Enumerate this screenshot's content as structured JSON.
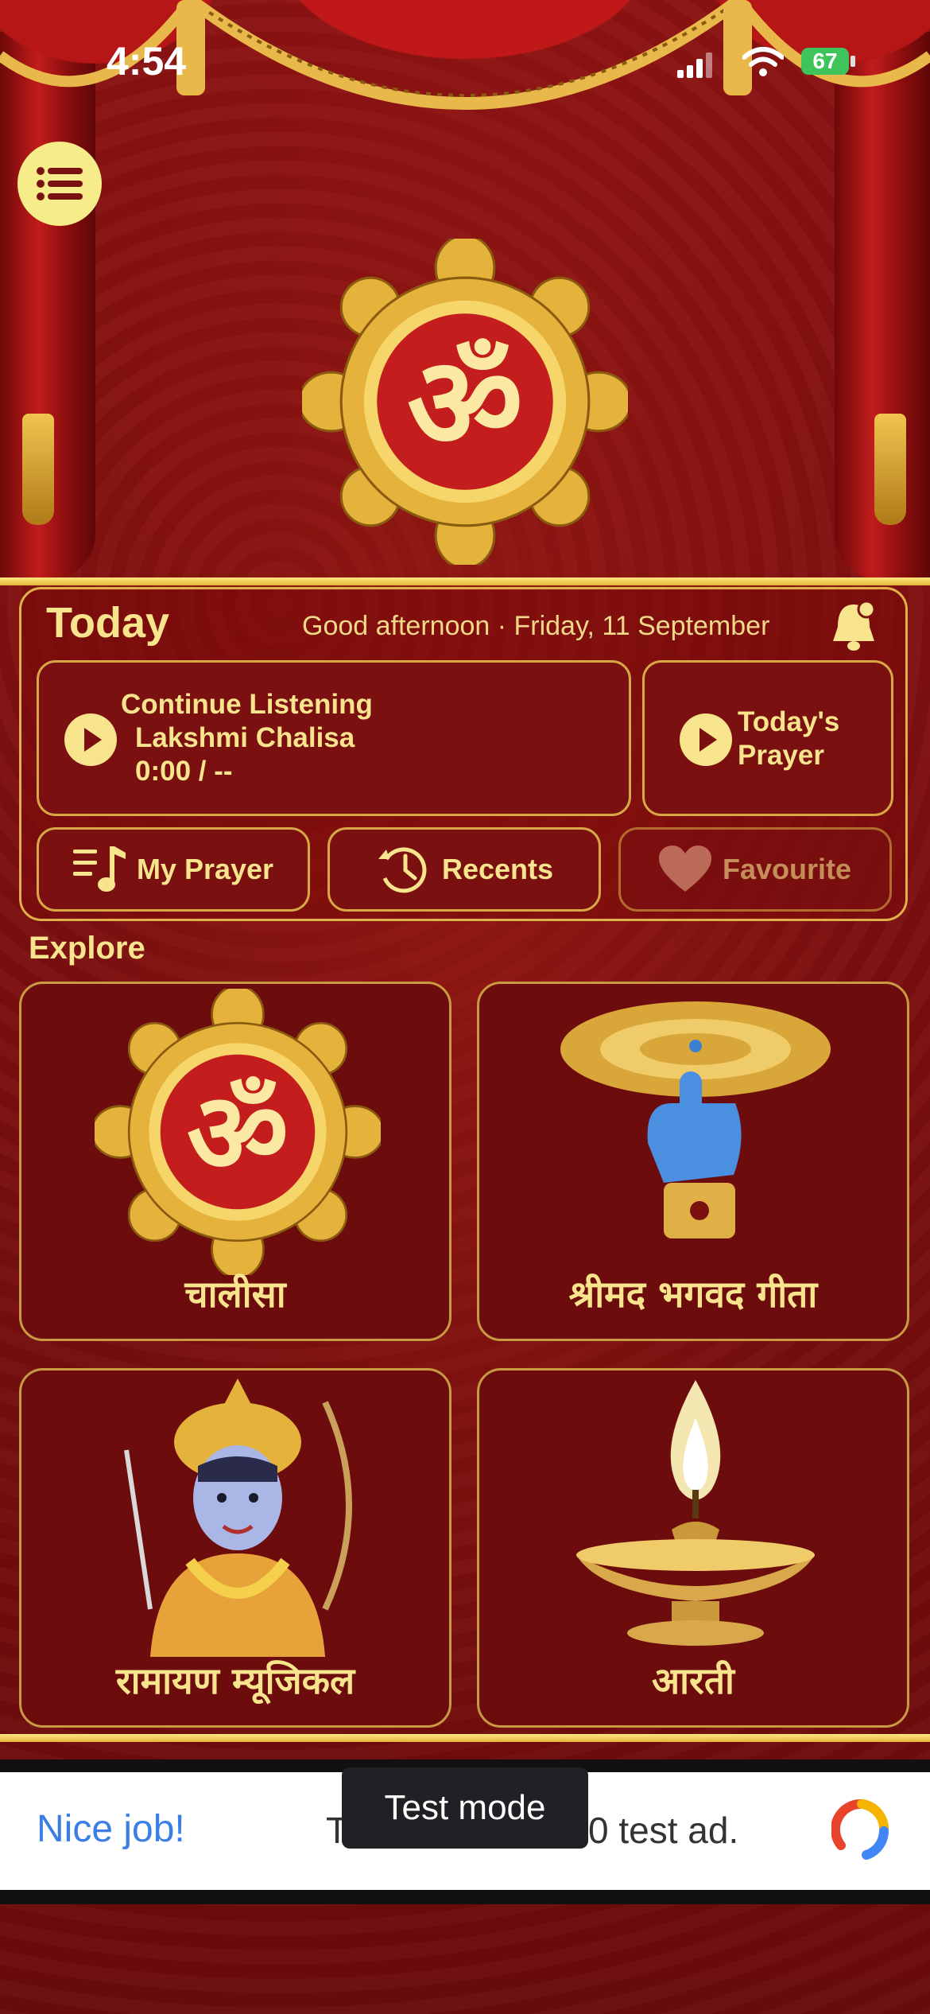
{
  "status_bar": {
    "time": "4:54",
    "battery": "67"
  },
  "today": {
    "title": "Today",
    "greeting": "Good afternoon · Friday, 11 September"
  },
  "continue_listening": {
    "label": "Continue Listening",
    "track": "Lakshmi Chalisa",
    "progress": "0:00 / --"
  },
  "todays_prayer": {
    "line1": "Today's",
    "line2": "Prayer"
  },
  "quick_actions": [
    {
      "label": "My Prayer",
      "icon": "playlist-music-icon"
    },
    {
      "label": "Recents",
      "icon": "history-icon"
    },
    {
      "label": "Favourite",
      "icon": "heart-icon"
    }
  ],
  "explore": {
    "title": "Explore",
    "tiles": [
      {
        "label": "चालीसा",
        "icon": "om-icon"
      },
      {
        "label": "श्रीमद भगवद गीता",
        "icon": "sudarshan-chakra-icon"
      },
      {
        "label": "रामायण म्यूजिकल",
        "icon": "lord-rama-icon"
      },
      {
        "label": "आरती",
        "icon": "diya-lamp-icon"
      }
    ]
  },
  "ad": {
    "left": "Nice job!",
    "middle_left": "T",
    "middle_right": "0 test ad.",
    "toast": "Test mode"
  },
  "colors": {
    "gold": "#f7e48c",
    "maroon": "#7a1010",
    "border": "#d7a845"
  }
}
